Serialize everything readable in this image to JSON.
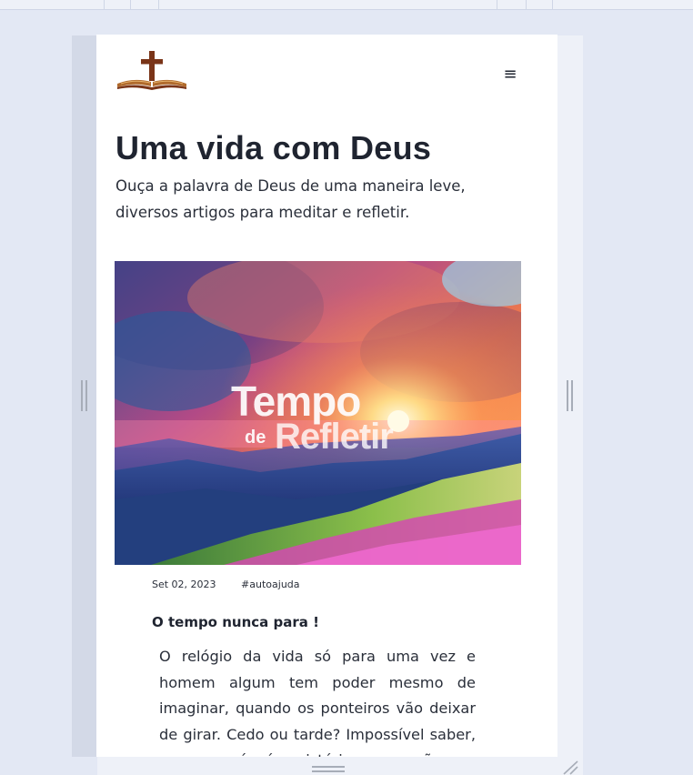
{
  "site": {
    "title": "Uma vida com Deus",
    "subtitle": "Ouça a palavra de Deus de uma maneira leve, diversos artigos para meditar e refletir."
  },
  "header": {
    "logo_icon": "cross-on-open-bible-icon",
    "menu_icon": "hamburger-menu-icon",
    "menu_glyph": "≡"
  },
  "post": {
    "image_text_line1": "Tempo",
    "image_text_line2_small": "de",
    "image_text_line2": "Refletir",
    "date": "Set 02, 2023",
    "tag": "#autoajuda",
    "title": "O tempo nunca para !",
    "body": "O relógio da vida só para uma vez e homem algum tem poder mesmo de imaginar, quando os ponteiros vão deixar de girar. Cedo ou tarde? Impossível saber, mesmo só é mistério que não se desvenda, em"
  },
  "colors": {
    "background": "#e3e8f4",
    "page": "#ffffff",
    "text": "#1f2430",
    "logo_brown": "#7a3418"
  }
}
